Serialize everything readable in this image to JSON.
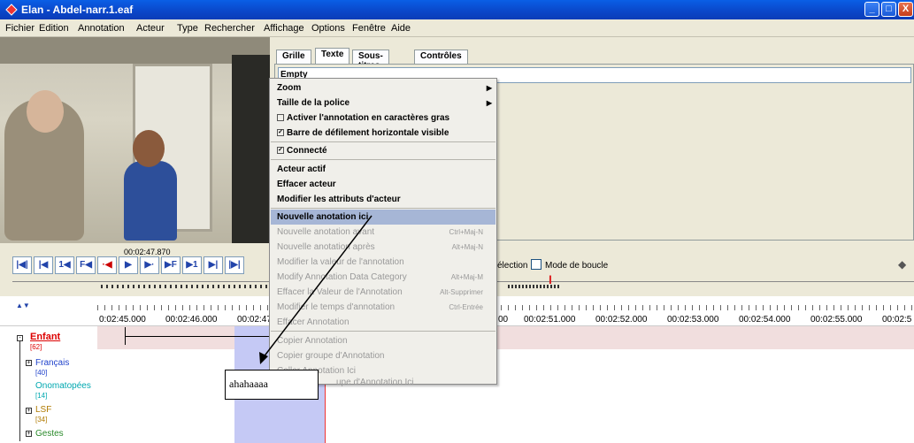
{
  "window": {
    "title": "Elan - Abdel-narr.1.eaf",
    "controls": [
      "_",
      "□",
      "X"
    ]
  },
  "menu": [
    "Fichier",
    "Edition",
    "Annotation",
    "Acteur",
    "Type",
    "Rechercher",
    "Affichage",
    "Options",
    "Fenêtre",
    "Aide"
  ],
  "player": {
    "timecode": "00:02:47.870",
    "buttons": [
      "|◀|",
      "|◀",
      "1◀",
      "F◀",
      "·◀",
      "▶",
      "▶·",
      "▶F",
      "▶1",
      "▶|",
      "|▶|"
    ]
  },
  "tabs": [
    "Grille",
    "Texte",
    "Sous-titres",
    "Contrôles"
  ],
  "panel": {
    "empty_text": "Empty"
  },
  "options": {
    "selection_label": "élection",
    "loop_label": "Mode de boucle"
  },
  "timeline": {
    "ticks": [
      "0:02:45.000",
      "00:02:46.000",
      "00:02:47",
      "00",
      "00:02:51.000",
      "00:02:52.000",
      "00:02:53.000",
      "00:02:54.000",
      "00:02:55.000",
      "00:02:5"
    ],
    "tiers": [
      {
        "name": "Enfant",
        "count": "[62]"
      },
      {
        "name": "Français",
        "count": "[40]"
      },
      {
        "name": "Onomatopées",
        "count": "[14]"
      },
      {
        "name": "LSF",
        "count": "[34]"
      },
      {
        "name": "Gestes",
        "count": ""
      }
    ]
  },
  "context_menu": {
    "items": [
      {
        "label": "Zoom",
        "submenu": true
      },
      {
        "label": "Taille de la police",
        "submenu": true
      },
      {
        "label": "Activer l'annotation en caractères gras",
        "checkbox": false
      },
      {
        "label": "Barre de défilement horizontale visible",
        "checkbox": true
      },
      {
        "label": "Connecté",
        "checkbox": true
      },
      {
        "label": "Acteur actif"
      },
      {
        "label": "Effacer acteur"
      },
      {
        "label": "Modifier les attributs d'acteur"
      },
      {
        "label": "Nouvelle anotation ici",
        "highlighted": true
      },
      {
        "label": "Nouvelle anotation avant",
        "shortcut": "Ctrl+Maj-N",
        "disabled": true
      },
      {
        "label": "Nouvelle anotation après",
        "shortcut": "Alt+Maj-N",
        "disabled": true
      },
      {
        "label": "Modifier la valeur de l'annotation",
        "disabled": true
      },
      {
        "label": "Modify Annotation Data Category",
        "shortcut": "Alt+Maj-M",
        "disabled": true
      },
      {
        "label": "Effacer la Valeur de l'Annotation",
        "shortcut": "Alt-Supprimer",
        "disabled": true
      },
      {
        "label": "Modifier le temps d'annotation",
        "shortcut": "Ctrl-Entrée",
        "disabled": true
      },
      {
        "label": "Effacer Annotation",
        "disabled": true
      },
      {
        "label": "Copier Annotation",
        "disabled": true
      },
      {
        "label": "Copier groupe d'Annotation",
        "disabled": true
      },
      {
        "label": "Coller Annotation Ici",
        "disabled": true
      },
      {
        "label": "upe d'Annotation Ici",
        "disabled": true
      }
    ]
  },
  "callout": {
    "text": "ahahaaaa"
  }
}
